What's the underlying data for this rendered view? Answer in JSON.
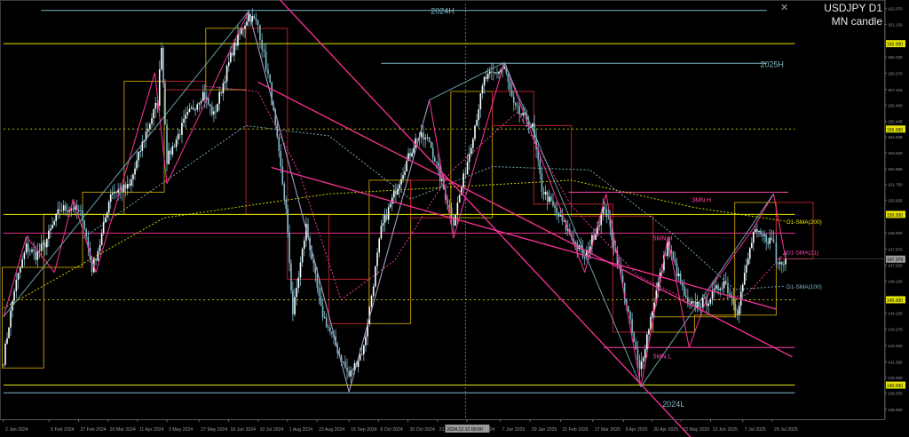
{
  "window": {
    "symbol_timeframe": "USDJPY D1",
    "subtitle": "MN candle",
    "close_glyph": "✕"
  },
  "chart_data": {
    "type": "candlestick",
    "title": "USDJPY D1",
    "subtitle": "MN candle",
    "x_tick_labels": [
      "2 Jan 2024",
      "5 Feb 2024",
      "27 Feb 2024",
      "20 Mar 2024",
      "11 Apr 2024",
      "3 May 2024",
      "27 May 2024",
      "18 Jun 2024",
      "10 Jul 2024",
      "1 Aug 2024",
      "23 Aug 2024",
      "16 Sep 2024",
      "8 Oct 2024",
      "30 Oct 2024",
      "21 Nov 2024",
      "13 Dec 2024",
      "7 Jan 2025",
      "29 Jan 2025",
      "21 Feb 2025",
      "17 Mar 2025",
      "9 Apr 2025",
      "30 Apr 2025",
      "22 May 2025",
      "13 Jun 2025",
      "7 Jul 2025",
      "29 Jul 2025"
    ],
    "x_tick_dates": [
      "2024-01-02",
      "2024-02-05",
      "2024-02-27",
      "2024-03-20",
      "2024-04-11",
      "2024-05-03",
      "2024-05-27",
      "2024-06-18",
      "2024-07-10",
      "2024-08-01",
      "2024-08-23",
      "2024-09-16",
      "2024-10-08",
      "2024-10-30",
      "2024-11-21",
      "2024-12-13",
      "2025-01-07",
      "2025-01-29",
      "2025-02-21",
      "2025-03-17",
      "2025-04-09",
      "2025-04-30",
      "2025-05-22",
      "2025-06-13",
      "2025-07-07",
      "2025-07-29"
    ],
    "crosshair_date_label": "2024.12.12 00:00",
    "crosshair_date": "2024-12-12",
    "y_tick_labels": [
      "162.070",
      "161.130",
      "160.000",
      "159.225",
      "158.270",
      "157.315",
      "156.400",
      "155.445",
      "155.000",
      "154.535",
      "153.620",
      "152.665",
      "151.750",
      "150.835",
      "150.000",
      "148.920",
      "147.970",
      "147.020",
      "146.100",
      "145.000",
      "144.230",
      "143.275",
      "142.320",
      "141.365",
      "140.450",
      "140.000",
      "139.535",
      "138.580"
    ],
    "ylim": [
      138.0,
      162.35
    ],
    "current_price_label": "147.379",
    "current_price": 147.379,
    "close_path": [
      {
        "date": "2024-01-02",
        "close": 141.5
      },
      {
        "date": "2024-01-10",
        "close": 145.6
      },
      {
        "date": "2024-01-19",
        "close": 148.1
      },
      {
        "date": "2024-01-26",
        "close": 147.6
      },
      {
        "date": "2024-02-02",
        "close": 148.3
      },
      {
        "date": "2024-02-13",
        "close": 150.3
      },
      {
        "date": "2024-02-23",
        "close": 150.4
      },
      {
        "date": "2024-03-01",
        "close": 149.9
      },
      {
        "date": "2024-03-08",
        "close": 146.8
      },
      {
        "date": "2024-03-14",
        "close": 148.3
      },
      {
        "date": "2024-03-22",
        "close": 151.3
      },
      {
        "date": "2024-04-05",
        "close": 151.6
      },
      {
        "date": "2024-04-16",
        "close": 154.5
      },
      {
        "date": "2024-04-26",
        "close": 156.6
      },
      {
        "date": "2024-04-29",
        "close": 160.0
      },
      {
        "date": "2024-05-03",
        "close": 153.2
      },
      {
        "date": "2024-05-17",
        "close": 155.6
      },
      {
        "date": "2024-05-30",
        "close": 157.1
      },
      {
        "date": "2024-06-07",
        "close": 155.8
      },
      {
        "date": "2024-06-21",
        "close": 159.6
      },
      {
        "date": "2024-07-03",
        "close": 161.7
      },
      {
        "date": "2024-07-10",
        "close": 161.1
      },
      {
        "date": "2024-07-19",
        "close": 157.5
      },
      {
        "date": "2024-07-31",
        "close": 150.2
      },
      {
        "date": "2024-08-05",
        "close": 144.2
      },
      {
        "date": "2024-08-15",
        "close": 149.3
      },
      {
        "date": "2024-08-26",
        "close": 144.4
      },
      {
        "date": "2024-09-06",
        "close": 142.3
      },
      {
        "date": "2024-09-16",
        "close": 140.5
      },
      {
        "date": "2024-09-27",
        "close": 142.2
      },
      {
        "date": "2024-10-10",
        "close": 149.1
      },
      {
        "date": "2024-10-25",
        "close": 152.3
      },
      {
        "date": "2024-11-06",
        "close": 154.6
      },
      {
        "date": "2024-11-15",
        "close": 154.3
      },
      {
        "date": "2024-11-27",
        "close": 151.1
      },
      {
        "date": "2024-12-03",
        "close": 149.6
      },
      {
        "date": "2024-12-12",
        "close": 152.6
      },
      {
        "date": "2024-12-26",
        "close": 157.9
      },
      {
        "date": "2025-01-10",
        "close": 158.6
      },
      {
        "date": "2025-01-17",
        "close": 156.3
      },
      {
        "date": "2025-01-31",
        "close": 155.1
      },
      {
        "date": "2025-02-07",
        "close": 151.5
      },
      {
        "date": "2025-02-25",
        "close": 149.2
      },
      {
        "date": "2025-03-11",
        "close": 147.4
      },
      {
        "date": "2025-03-26",
        "close": 150.5
      },
      {
        "date": "2025-04-07",
        "close": 146.4
      },
      {
        "date": "2025-04-21",
        "close": 140.8
      },
      {
        "date": "2025-05-02",
        "close": 145.0
      },
      {
        "date": "2025-05-12",
        "close": 148.3
      },
      {
        "date": "2025-05-27",
        "close": 144.6
      },
      {
        "date": "2025-06-10",
        "close": 144.9
      },
      {
        "date": "2025-06-23",
        "close": 146.1
      },
      {
        "date": "2025-07-03",
        "close": 144.4
      },
      {
        "date": "2025-07-15",
        "close": 148.9
      },
      {
        "date": "2025-07-30",
        "close": 148.4
      },
      {
        "date": "2025-08-01",
        "close": 147.1
      },
      {
        "date": "2025-08-08",
        "close": 147.4
      }
    ],
    "horizontal_levels": [
      {
        "label": "2024H",
        "value": 161.95,
        "color": "#7fb9c9",
        "start": "2024-01-30",
        "end": "2025-07-25"
      },
      {
        "label": "2025H",
        "value": 158.85,
        "color": "#7fb9c9",
        "start": "2024-10-10",
        "end": "2025-07-25"
      },
      {
        "label": "2024L",
        "value": 139.55,
        "color": "#7fb9c9",
        "start": "2024-01-02",
        "end": "2025-08-15"
      },
      {
        "label": "",
        "value": 160.0,
        "color": "#e4e400",
        "start": "2024-01-02",
        "end": "2025-08-15"
      },
      {
        "label": "",
        "value": 155.0,
        "color": "#b9b900",
        "start": "2024-01-02",
        "end": "2025-08-15",
        "dashed": true
      },
      {
        "label": "",
        "value": 150.0,
        "color": "#e4e400",
        "start": "2024-01-02",
        "end": "2025-08-15"
      },
      {
        "label": "",
        "value": 145.0,
        "color": "#b9b900",
        "start": "2024-01-02",
        "end": "2025-08-15",
        "dashed": true
      },
      {
        "label": "",
        "value": 140.0,
        "color": "#e4e400",
        "start": "2024-01-02",
        "end": "2025-08-15"
      },
      {
        "label": "",
        "value": 148.9,
        "color": "#e0308a",
        "start": "2024-01-02",
        "end": "2025-08-15"
      },
      {
        "label": "3MN.H",
        "value": 151.3,
        "color": "#ff44aa",
        "start": "2025-02-27",
        "end": "2025-08-10"
      },
      {
        "label": "5MN.H",
        "value": 148.7,
        "color": "#ff44aa",
        "start": "2025-04-25",
        "end": "2025-05-20",
        "label_only": true
      },
      {
        "label": "5MN.L",
        "value": 142.2,
        "color": "#ff44aa",
        "start": "2025-03-25",
        "end": "2025-08-15"
      }
    ],
    "trendlines": [
      {
        "from": {
          "date": "2024-07-05",
          "value": 164.35
        },
        "to": {
          "date": "2025-06-10",
          "value": 135.95
        },
        "color": "#ff3399"
      },
      {
        "from": {
          "date": "2024-07-10",
          "value": 157.75
        },
        "to": {
          "date": "2025-08-13",
          "value": 141.65
        },
        "color": "#ff3399"
      },
      {
        "from": {
          "date": "2024-07-20",
          "value": 152.75
        },
        "to": {
          "date": "2025-08-01",
          "value": 144.45
        },
        "color": "#ff3399"
      }
    ],
    "zigzag_pivots": [
      {
        "date": "2024-01-02",
        "value": 144.0
      },
      {
        "date": "2024-01-19",
        "value": 148.7
      },
      {
        "date": "2024-02-09",
        "value": 146.6
      },
      {
        "date": "2024-02-23",
        "value": 150.9
      },
      {
        "date": "2024-03-11",
        "value": 146.6
      },
      {
        "date": "2024-04-24",
        "value": 158.3
      },
      {
        "date": "2024-05-03",
        "value": 151.8
      },
      {
        "date": "2024-07-03",
        "value": 161.9
      },
      {
        "date": "2024-09-16",
        "value": 139.6
      },
      {
        "date": "2024-11-15",
        "value": 156.7
      },
      {
        "date": "2024-12-03",
        "value": 148.6
      },
      {
        "date": "2025-01-10",
        "value": 158.9
      },
      {
        "date": "2025-03-11",
        "value": 146.6
      },
      {
        "date": "2025-03-27",
        "value": 151.2
      },
      {
        "date": "2025-04-22",
        "value": 139.9
      },
      {
        "date": "2025-05-12",
        "value": 148.6
      },
      {
        "date": "2025-05-28",
        "value": 142.2
      },
      {
        "date": "2025-06-13",
        "value": 145.7
      },
      {
        "date": "2025-07-15",
        "value": 149.2
      },
      {
        "date": "2025-07-30",
        "value": 151.2
      },
      {
        "date": "2025-08-08",
        "value": 147.4
      }
    ],
    "monthly_candle_boxes": [
      {
        "month": "2024-01",
        "open": 141.0,
        "close": 146.9
      },
      {
        "month": "2024-02",
        "open": 146.9,
        "close": 150.0
      },
      {
        "month": "2024-03",
        "open": 150.0,
        "close": 151.3
      },
      {
        "month": "2024-04",
        "open": 151.3,
        "close": 157.8
      },
      {
        "month": "2024-05",
        "open": 157.8,
        "close": 157.3
      },
      {
        "month": "2024-06",
        "open": 157.3,
        "close": 160.9
      },
      {
        "month": "2024-07",
        "open": 160.9,
        "close": 150.0
      },
      {
        "month": "2024-08",
        "open": 150.0,
        "close": 146.2
      },
      {
        "month": "2024-09",
        "open": 146.2,
        "close": 143.6
      },
      {
        "month": "2024-10",
        "open": 143.6,
        "close": 152.0
      },
      {
        "month": "2024-11",
        "open": 152.0,
        "close": 149.8
      },
      {
        "month": "2024-12",
        "open": 149.8,
        "close": 157.2
      },
      {
        "month": "2025-01",
        "open": 157.2,
        "close": 155.2
      },
      {
        "month": "2025-02",
        "open": 155.2,
        "close": 150.6
      },
      {
        "month": "2025-03",
        "open": 150.6,
        "close": 149.9
      },
      {
        "month": "2025-04",
        "open": 149.9,
        "close": 143.1
      },
      {
        "month": "2025-05",
        "open": 143.1,
        "close": 144.0
      },
      {
        "month": "2025-06",
        "open": 144.0,
        "close": 144.1
      },
      {
        "month": "2025-07",
        "open": 144.1,
        "close": 150.7
      },
      {
        "month": "2025-08",
        "open": 150.7,
        "close": 147.4
      }
    ],
    "moving_averages": [
      {
        "name": "D1-SMA(200)",
        "label_value": 149.6,
        "color": "#e4e400",
        "dashed": true,
        "points": [
          {
            "date": "2024-01-02",
            "value": 144.5
          },
          {
            "date": "2024-05-01",
            "value": 149.8
          },
          {
            "date": "2024-09-01",
            "value": 151.2
          },
          {
            "date": "2024-12-01",
            "value": 151.6
          },
          {
            "date": "2025-03-01",
            "value": 152.0
          },
          {
            "date": "2025-06-01",
            "value": 150.4
          },
          {
            "date": "2025-08-08",
            "value": 149.6
          }
        ]
      },
      {
        "name": "D1-SMA(21)",
        "label_value": 147.8,
        "color": "#ff44aa",
        "dashed": true,
        "points": [
          {
            "date": "2024-06-01",
            "value": 157.5
          },
          {
            "date": "2024-07-10",
            "value": 157.2
          },
          {
            "date": "2024-08-10",
            "value": 152.4
          },
          {
            "date": "2024-09-10",
            "value": 145.0
          },
          {
            "date": "2024-10-20",
            "value": 147.3
          },
          {
            "date": "2024-12-01",
            "value": 152.5
          },
          {
            "date": "2025-01-20",
            "value": 156.0
          },
          {
            "date": "2025-03-01",
            "value": 150.5
          },
          {
            "date": "2025-04-20",
            "value": 146.4
          },
          {
            "date": "2025-06-01",
            "value": 144.8
          },
          {
            "date": "2025-07-10",
            "value": 145.3
          },
          {
            "date": "2025-08-08",
            "value": 147.8
          }
        ]
      },
      {
        "name": "D1-SMA(100)",
        "label_value": 145.8,
        "color": "#7fb9c9",
        "dashed": true,
        "points": [
          {
            "date": "2024-03-01",
            "value": 148.6
          },
          {
            "date": "2024-07-01",
            "value": 155.2
          },
          {
            "date": "2024-09-01",
            "value": 154.6
          },
          {
            "date": "2024-11-01",
            "value": 150.9
          },
          {
            "date": "2025-01-01",
            "value": 152.8
          },
          {
            "date": "2025-03-15",
            "value": 152.6
          },
          {
            "date": "2025-05-15",
            "value": 148.9
          },
          {
            "date": "2025-07-01",
            "value": 145.6
          },
          {
            "date": "2025-08-08",
            "value": 145.8
          }
        ]
      }
    ],
    "colors": {
      "background": "#000000",
      "candle": "#7fb9c9",
      "level_cyan": "#7fb9c9",
      "level_yellow": "#e4e400",
      "pink": "#ff3399",
      "box_yellow": "#b38f00",
      "box_red": "#b0202a",
      "crosshair": "#6a6a6a",
      "axis_text": "#9a9a9a"
    }
  }
}
